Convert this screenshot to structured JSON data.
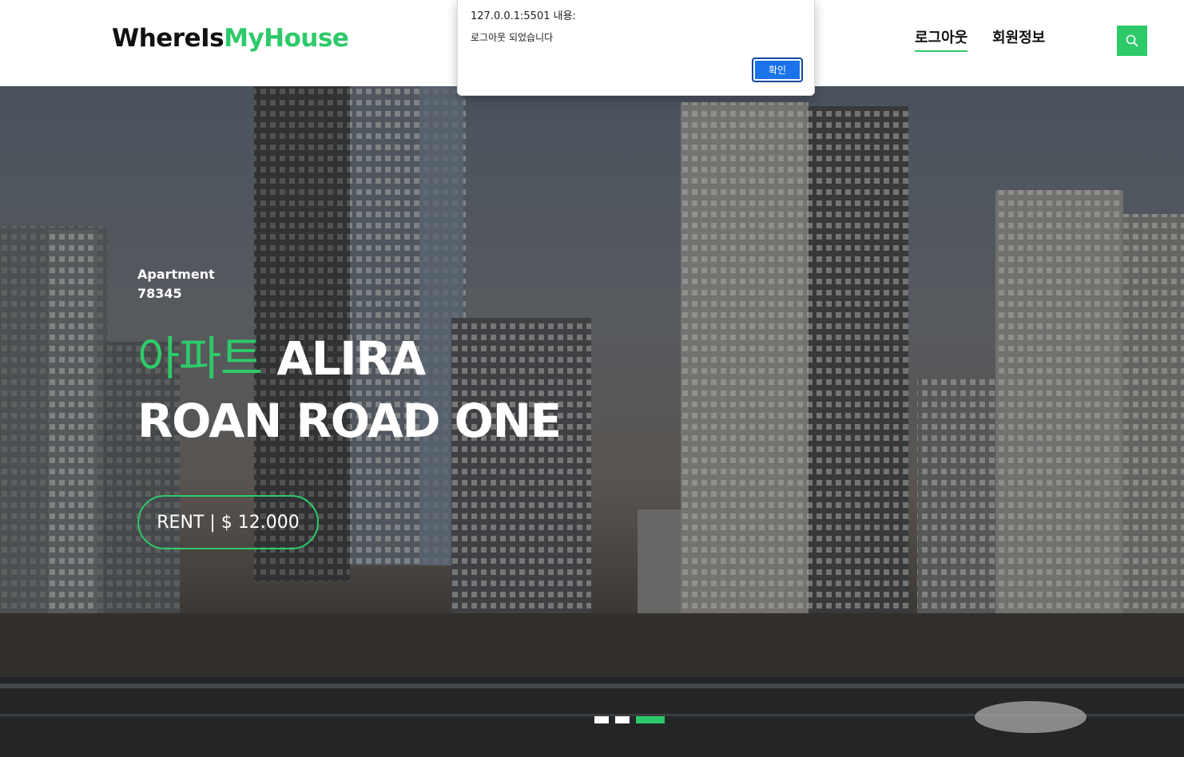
{
  "header": {
    "brand_prefix": "WhereIs",
    "brand_accent": "MyHouse",
    "nav": [
      {
        "label": "로그아웃",
        "active": true
      },
      {
        "label": "회원정보",
        "active": false
      }
    ],
    "search_icon": "search-icon"
  },
  "hero": {
    "subtitle_line1": "Apartment",
    "subtitle_line2": "78345",
    "title_accent": "아파트",
    "title_line1": " ALIRA",
    "title_line2": "ROAN ROAD ONE",
    "price_label": "RENT | $ 12.000",
    "carousel": {
      "total": 3,
      "active_index": 3
    }
  },
  "alert": {
    "origin": "127.0.0.1:5501 내용:",
    "message": "로그아웃 되었습니다",
    "ok_label": "확인"
  },
  "colors": {
    "accent": "#2eca6a",
    "alert_button": "#1a73e8",
    "text_dark": "#111111"
  }
}
